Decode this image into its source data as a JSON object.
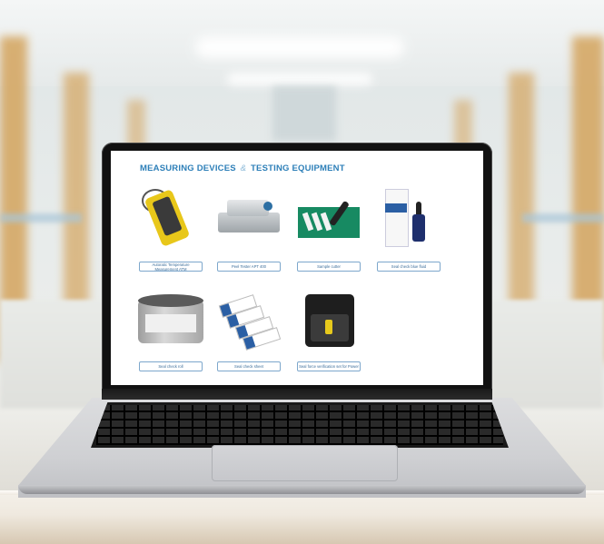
{
  "page": {
    "title_part1": "MEASURING DEVICES",
    "title_amp": "&",
    "title_part2": "TESTING EQUIPMENT"
  },
  "products": [
    {
      "name": "Autoratic Temperature Measurement ATM",
      "icon": "digital-thermometer"
    },
    {
      "name": "Peel Tester APT 400",
      "icon": "peel-tester"
    },
    {
      "name": "Sample cutter",
      "icon": "sample-cutter"
    },
    {
      "name": "Seal check blue fluid",
      "icon": "blue-fluid-bottle"
    },
    {
      "name": "Seal check roll",
      "icon": "indicator-roll"
    },
    {
      "name": "Seal check sheet",
      "icon": "indicator-sheets"
    },
    {
      "name": "Seal force verification set for Power",
      "icon": "verification-case"
    }
  ],
  "colors": {
    "title": "#2d7fb8",
    "button_border": "#7da7cc",
    "button_text": "#3a6c99"
  }
}
